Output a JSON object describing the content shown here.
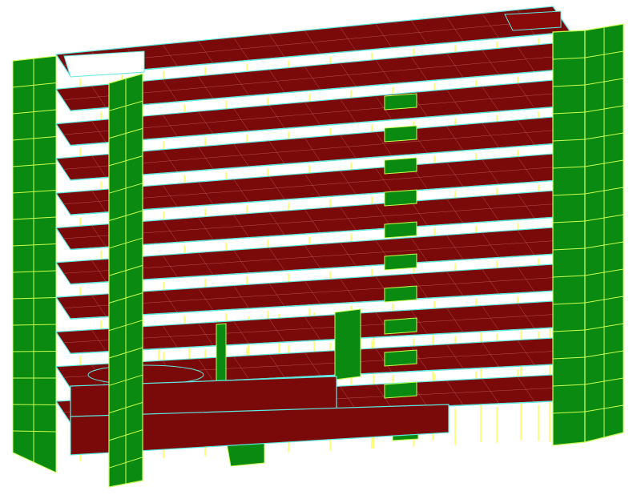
{
  "model": {
    "kind": "3D structural frame model",
    "stories": 11,
    "elements": {
      "slab": {
        "color": "#7a0a0a",
        "edge": "#5fe8e0",
        "mesh": "#b45050"
      },
      "shear_wall": {
        "color": "#0b8a12",
        "edge": "#c8ff50"
      },
      "column": {
        "color": "#ffff28"
      }
    },
    "background": "#ffffff"
  }
}
